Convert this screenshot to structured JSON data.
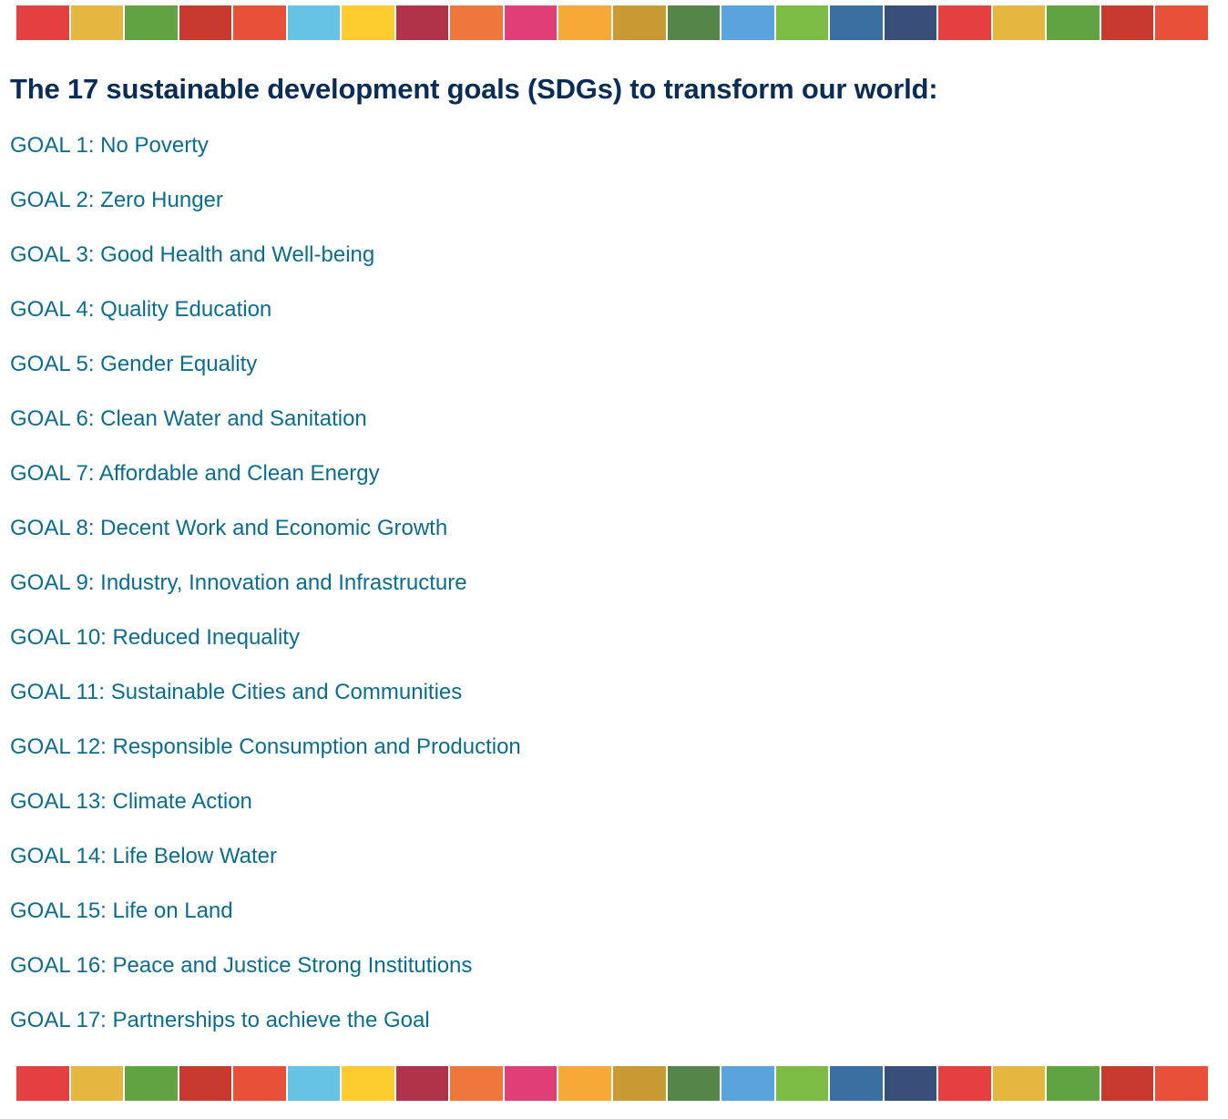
{
  "title": "The 17 sustainable development goals (SDGs) to transform our world:",
  "colors": {
    "title": "#0a2d57",
    "link": "#0b6c8f",
    "bar": [
      "#e4403f",
      "#e5b740",
      "#61a342",
      "#c8392f",
      "#e9503a",
      "#67c3e6",
      "#fccc2e",
      "#b0324b",
      "#ee773b",
      "#e03e76",
      "#f6a936",
      "#c99933",
      "#568549",
      "#5aa3dc",
      "#7cbc45",
      "#3b6ea3",
      "#394f79",
      "#e4403f",
      "#e5b740",
      "#61a342",
      "#c8392f",
      "#e9503a"
    ]
  },
  "goals": [
    {
      "label": "GOAL 1: No Poverty"
    },
    {
      "label": "GOAL 2: Zero Hunger"
    },
    {
      "label": "GOAL 3: Good Health and Well-being"
    },
    {
      "label": "GOAL 4: Quality Education"
    },
    {
      "label": "GOAL 5: Gender Equality"
    },
    {
      "label": "GOAL 6: Clean Water and Sanitation"
    },
    {
      "label": "GOAL 7: Affordable and Clean Energy"
    },
    {
      "label": "GOAL 8: Decent Work and Economic Growth"
    },
    {
      "label": "GOAL 9: Industry, Innovation and Infrastructure"
    },
    {
      "label": "GOAL 10: Reduced Inequality"
    },
    {
      "label": "GOAL 11: Sustainable Cities and Communities"
    },
    {
      "label": "GOAL 12: Responsible Consumption and Production"
    },
    {
      "label": "GOAL 13: Climate Action"
    },
    {
      "label": "GOAL 14: Life Below Water"
    },
    {
      "label": "GOAL 15: Life on Land"
    },
    {
      "label": "GOAL 16: Peace and Justice Strong Institutions"
    },
    {
      "label": "GOAL 17: Partnerships to achieve the Goal"
    }
  ]
}
